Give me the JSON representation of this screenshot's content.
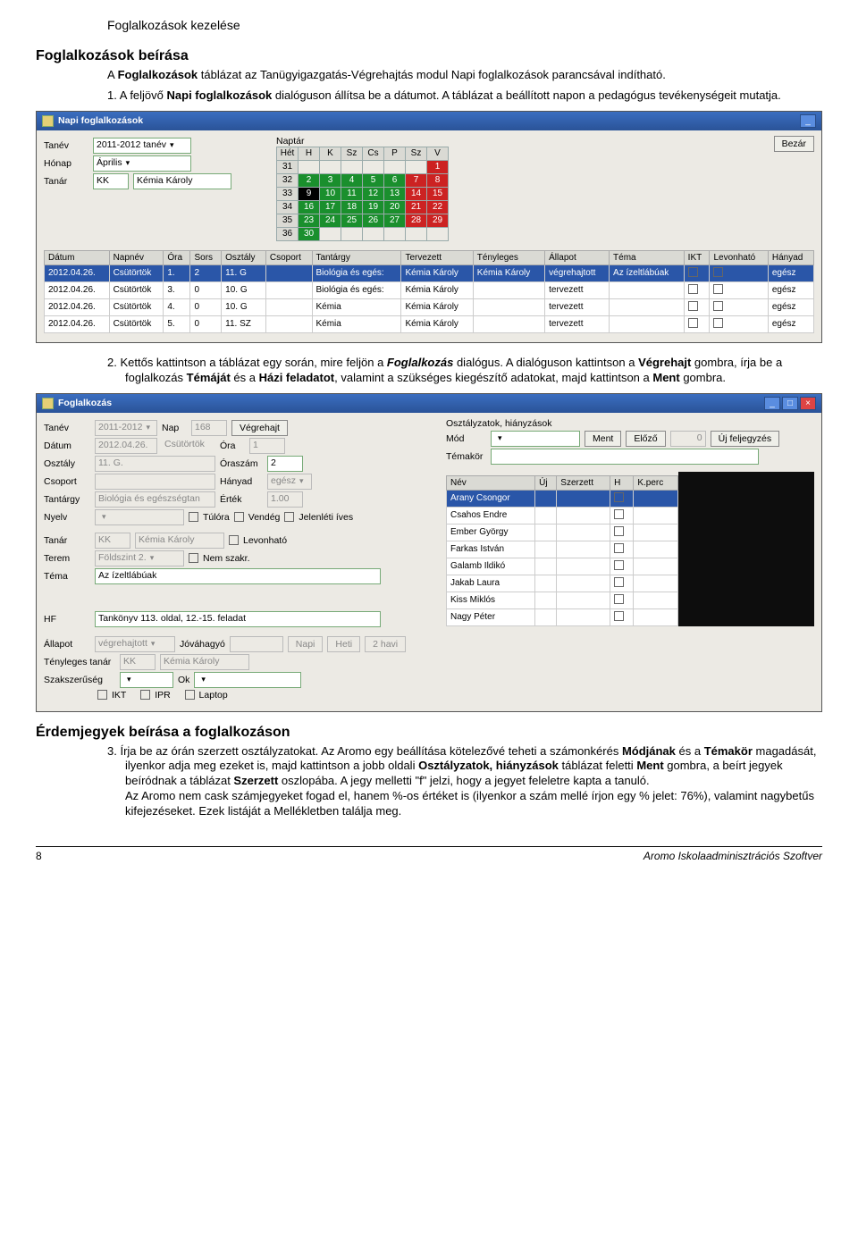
{
  "doc": {
    "header": "Foglalkozások kezelése",
    "h2_1": "Foglalkozások beírása",
    "p1_a": "A ",
    "p1_b": "Foglalkozások",
    "p1_c": " táblázat az Tanügyigazgatás-Végrehajtás modul Napi foglalkozások parancsával indítható.",
    "li1_n": "1. ",
    "li1_a": "A feljövő ",
    "li1_b": "Napi foglalkozások",
    "li1_c": " dialóguson állítsa be a dátumot. A táblázat a beállított napon a pedagógus tevékenységeit mutatja.",
    "li2_n": "2. ",
    "li2_a": "Kettős kattintson a táblázat egy során, mire feljön a ",
    "li2_b": "Foglalkozás",
    "li2_c": " dialógus. A dialóguson kattintson a ",
    "li2_d": "Végrehajt",
    "li2_e": " gombra, írja be a foglalkozás ",
    "li2_f": "Témáját",
    "li2_g": " és a ",
    "li2_h": "Házi feladatot",
    "li2_i": ", valamint a szükséges kiegészítő adatokat, majd kattintson a ",
    "li2_j": "Ment",
    "li2_k": " gombra.",
    "h2_2": "Érdemjegyek beírása a foglalkozáson",
    "li3_n": "3. ",
    "li3_a": "Írja be az órán szerzett osztályzatokat. Az Aromo egy beállítása kötelezővé teheti a számonkérés ",
    "li3_b": "Módjának",
    "li3_c": " és a ",
    "li3_d": "Témakör",
    "li3_e": " magadását, ilyenkor adja meg ezeket is, majd kattintson a jobb oldali ",
    "li3_f": "Osztályzatok, hiányzások",
    "li3_g": " táblázat feletti ",
    "li3_h": "Ment",
    "li3_i": " gombra, a beírt jegyek beíródnak a táblázat ",
    "li3_j": "Szerzett",
    "li3_k": " oszlopába. A jegy melletti \"f\" jelzi, hogy a jegyet feleletre kapta a tanuló.",
    "li3_l": "Az Aromo nem cask számjegyeket fogad el, hanem %-os értéket is (ilyenkor a szám mellé írjon egy % jelet: 76%), valamint nagybetűs kifejezéseket. Ezek listáját a Mellékletben találja meg."
  },
  "win1": {
    "title": "Napi foglalkozások",
    "labels": {
      "tanev": "Tanév",
      "honap": "Hónap",
      "tanar": "Tanár",
      "naptar": "Naptár"
    },
    "vals": {
      "tanev": "2011-2012 tanév",
      "honap": "Április",
      "tanar_code": "KK",
      "tanar_name": "Kémia Károly"
    },
    "close": "Bezár",
    "days": [
      "Hét",
      "H",
      "K",
      "Sz",
      "Cs",
      "P",
      "Sz",
      "V"
    ],
    "weeks": [
      {
        "w": "31",
        "d": [
          "",
          "",
          "",
          "",
          "",
          "",
          "1"
        ]
      },
      {
        "w": "32",
        "d": [
          "2",
          "3",
          "4",
          "5",
          "6",
          "7",
          "8"
        ]
      },
      {
        "w": "33",
        "d": [
          "9",
          "10",
          "11",
          "12",
          "13",
          "14",
          "15"
        ]
      },
      {
        "w": "34",
        "d": [
          "16",
          "17",
          "18",
          "19",
          "20",
          "21",
          "22"
        ]
      },
      {
        "w": "35",
        "d": [
          "23",
          "24",
          "25",
          "26",
          "27",
          "28",
          "29"
        ]
      },
      {
        "w": "36",
        "d": [
          "30",
          "",
          "",
          "",
          "",
          "",
          ""
        ]
      }
    ],
    "cols": [
      "Dátum",
      "Napnév",
      "Óra",
      "Sors",
      "Osztály",
      "Csoport",
      "Tantárgy",
      "Tervezett",
      "Tényleges",
      "Állapot",
      "Téma",
      "IKT",
      "Levonható",
      "Hányad"
    ],
    "rows": [
      [
        "2012.04.26.",
        "Csütörtök",
        "1.",
        "2",
        "11. G",
        "",
        "Biológia és egés:",
        "Kémia Károly",
        "Kémia Károly",
        "végrehajtott",
        "Az ízeltlábúak",
        "",
        "",
        "egész"
      ],
      [
        "2012.04.26.",
        "Csütörtök",
        "3.",
        "0",
        "10. G",
        "",
        "Biológia és egés:",
        "Kémia Károly",
        "",
        "tervezett",
        "",
        "",
        "",
        "egész"
      ],
      [
        "2012.04.26.",
        "Csütörtök",
        "4.",
        "0",
        "10. G",
        "",
        "Kémia",
        "Kémia Károly",
        "",
        "tervezett",
        "",
        "",
        "",
        "egész"
      ],
      [
        "2012.04.26.",
        "Csütörtök",
        "5.",
        "0",
        "11. SZ",
        "",
        "Kémia",
        "Kémia Károly",
        "",
        "tervezett",
        "",
        "",
        "",
        "egész"
      ]
    ]
  },
  "win2": {
    "title": "Foglalkozás",
    "labels": {
      "tanev": "Tanév",
      "nap": "Nap",
      "vegrehajt": "Végrehajt",
      "datum": "Dátum",
      "ora": "Óra",
      "osztaly": "Osztály",
      "oraszam": "Óraszám",
      "csoport": "Csoport",
      "hanyad": "Hányad",
      "tantargy": "Tantárgy",
      "ertek": "Érték",
      "nyelv": "Nyelv",
      "tulora": "Túlóra",
      "vendeg": "Vendég",
      "jelenleti": "Jelenléti íves",
      "tanar": "Tanár",
      "levonhato": "Levonható",
      "terem": "Terem",
      "nemszakr": "Nem szakr.",
      "tema": "Téma",
      "hf": "HF",
      "allapot": "Állapot",
      "jovahagyo": "Jóváhagyó",
      "napi": "Napi",
      "heti": "Heti",
      "havi2": "2 havi",
      "tenyleges": "Tényleges tanár",
      "szaksz": "Szakszerűség",
      "ok": "Ok",
      "ikt": "IKT",
      "ipr": "IPR",
      "laptop": "Laptop",
      "osztalyzatok": "Osztályzatok, hiányzások",
      "mod": "Mód",
      "ment": "Ment",
      "elozo": "Előző",
      "ujfel": "Új feljegyzés",
      "temakor": "Témakör"
    },
    "vals": {
      "tanev": "2011-2012",
      "nap": "168",
      "datum": "2012.04.26.",
      "datum_nev": "Csütörtök",
      "ora": "1",
      "osztaly": "11. G.",
      "oraszam": "2",
      "hanyad": "egész",
      "tantargy": "Biológia és egészségtan",
      "ertek": "1.00",
      "tanar_code": "KK",
      "tanar_name": "Kémia Károly",
      "terem": "Földszint 2.",
      "tema": "Az ízeltlábúak",
      "hf": "Tankönyv 113. oldal, 12.-15. feladat",
      "allapot": "végrehajtott",
      "tenyleges_code": "KK",
      "tenyleges_name": "Kémia Károly",
      "elozo_num": "0"
    },
    "studcols": [
      "Név",
      "Új",
      "Szerzett",
      "H",
      "K.perc"
    ],
    "students": [
      "Arany Csongor",
      "Csahos Endre",
      "Ember György",
      "Farkas István",
      "Galamb Ildikó",
      "Jakab Laura",
      "Kiss Miklós",
      "Nagy Péter"
    ]
  },
  "footer": {
    "page": "8",
    "prod": "Aromo Iskolaadminisztrációs Szoftver"
  }
}
